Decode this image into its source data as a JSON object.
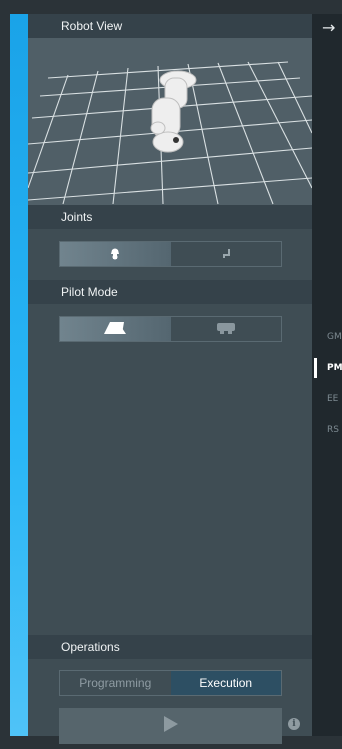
{
  "panel": {
    "robot_view_title": "Robot View",
    "joints_title": "Joints",
    "pilot_mode_title": "Pilot Mode",
    "operations_title": "Operations"
  },
  "joints": {
    "options": [
      "robot-arm-icon",
      "joint-icon"
    ],
    "selected": 0
  },
  "pilot_mode": {
    "options": [
      "plane-icon",
      "tool-icon"
    ],
    "selected": 0
  },
  "operations": {
    "programming_label": "Programming",
    "execution_label": "Execution",
    "selected": "Execution"
  },
  "side_tabs": {
    "items": [
      "GM",
      "PM",
      "EE",
      "RS"
    ],
    "active": "PM"
  },
  "colors": {
    "accent": "#29b6f6",
    "panel": "#3f4d54",
    "header": "#35424a",
    "strip": "#20282d"
  }
}
